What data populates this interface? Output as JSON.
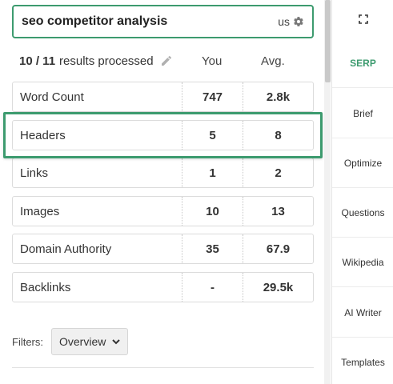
{
  "search": {
    "value": "seo competitor analysis",
    "country": "us"
  },
  "results": {
    "count": "10 / 11",
    "suffix": "results processed",
    "col_you": "You",
    "col_avg": "Avg."
  },
  "metrics": [
    {
      "label": "Word Count",
      "you": "747",
      "avg": "2.8k"
    },
    {
      "label": "Headers",
      "you": "5",
      "avg": "8"
    },
    {
      "label": "Links",
      "you": "1",
      "avg": "2"
    },
    {
      "label": "Images",
      "you": "10",
      "avg": "13"
    },
    {
      "label": "Domain Authority",
      "you": "35",
      "avg": "67.9"
    },
    {
      "label": "Backlinks",
      "you": "-",
      "avg": "29.5k"
    }
  ],
  "filters": {
    "label": "Filters:",
    "selected": "Overview"
  },
  "nav": [
    {
      "label": "SERP",
      "active": true
    },
    {
      "label": "Brief"
    },
    {
      "label": "Optimize"
    },
    {
      "label": "Questions"
    },
    {
      "label": "Wikipedia"
    },
    {
      "label": "AI Writer"
    },
    {
      "label": "Templates"
    }
  ],
  "colors": {
    "accent": "#3d9b6f"
  }
}
